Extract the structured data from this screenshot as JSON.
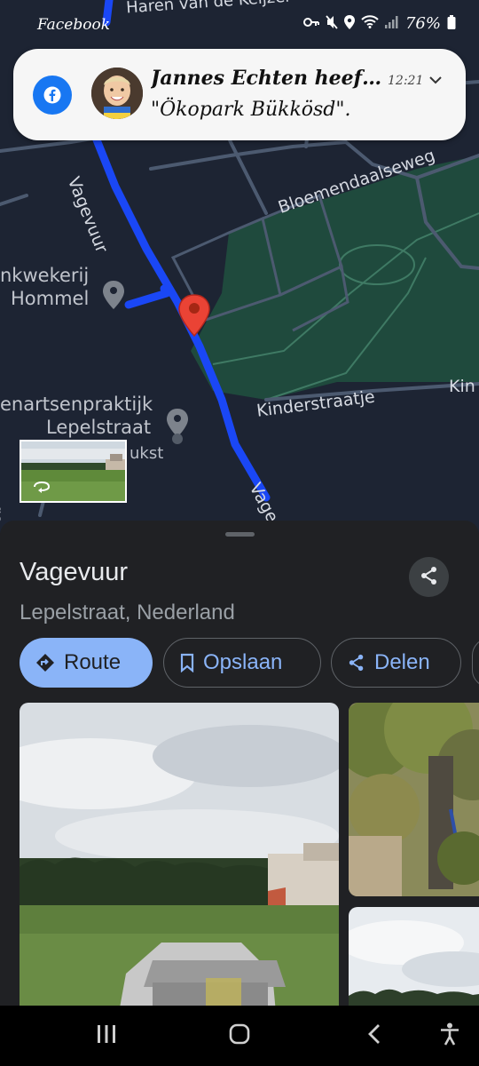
{
  "status_bar": {
    "app_name": "Facebook",
    "battery_percent": "76%",
    "icons": [
      "key-icon",
      "mute-icon",
      "location-icon",
      "wifi-icon",
      "signal-icon",
      "battery-icon"
    ]
  },
  "notification": {
    "app": "Facebook",
    "title": "Jannes Echten heef…",
    "body": "\"Ökopark Bükkösd\".",
    "time": "12:21",
    "accent_color": "#1877f2"
  },
  "map": {
    "streets": {
      "top": "Haren van de Keijzer",
      "vagevuur": "Vagevuur",
      "bloemendaalseweg": "Bloemendaalseweg",
      "kinderstraatje": "Kinderstraatje",
      "kinderstraatje_right": "Kin",
      "vagevuur_bottom": "Vage",
      "left_edge": "ge"
    },
    "pois": {
      "kwekerij_line1": "nkwekerij",
      "kwekerij_line2": "Hommel",
      "praktijk_line1": "enartsenpraktijk",
      "praktijk_line2": "Lepelstraat",
      "partial": "ukst"
    },
    "route_color": "#1a47f5",
    "pin_color": "#ea4335",
    "park_color": "#1f4a3d"
  },
  "place": {
    "title": "Vagevuur",
    "subtitle": "Lepelstraat, Nederland"
  },
  "actions": {
    "route": "Route",
    "save": "Opslaan",
    "share": "Delen"
  },
  "colors": {
    "sheet_bg": "#202124",
    "accent_blue": "#8ab4f8"
  }
}
